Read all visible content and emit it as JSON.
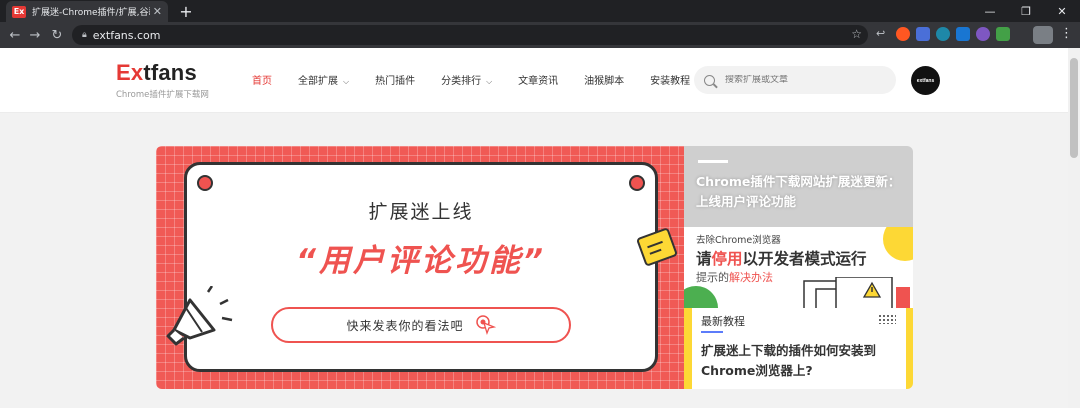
{
  "browser": {
    "tab_favicon": "Ex",
    "tab_title": "扩展迷-Chrome插件/扩展,谷歌浏",
    "tab_close": "✕",
    "new_tab": "+",
    "url": "extfans.com",
    "window_controls": [
      "—",
      "❐",
      "✕"
    ]
  },
  "header": {
    "logo_ex": "Ex",
    "logo_rest": "tfans",
    "logo_sub": "Chrome插件扩展下载网",
    "nav": [
      {
        "label": "首页",
        "active": true
      },
      {
        "label": "全部扩展",
        "dropdown": true
      },
      {
        "label": "热门插件"
      },
      {
        "label": "分类排行",
        "dropdown": true
      },
      {
        "label": "文章资讯"
      },
      {
        "label": "油猴脚本"
      },
      {
        "label": "安装教程"
      }
    ],
    "search_placeholder": "搜索扩展或文章",
    "avatar_text": "extfans"
  },
  "banner": {
    "title": "扩展迷上线",
    "headline": "“用户评论功能”",
    "button": "快来发表你的看法吧"
  },
  "side": {
    "top_title": "Chrome插件下载网站扩展迷更新：上线用户评论功能",
    "mid_small": "去除Chrome浏览器",
    "mid_big_1": "请",
    "mid_big_red": "停用",
    "mid_big_2": "以开发者模式运行",
    "mid_sub_1": "提示的",
    "mid_sub_red": "解决办法",
    "bot_label": "最新教程",
    "bot_title": "扩展迷上下载的插件如何安装到Chrome浏览器上?"
  },
  "colors": {
    "accent": "#e53935",
    "banner_bg": "#f05a55",
    "yellow": "#fdd835"
  }
}
